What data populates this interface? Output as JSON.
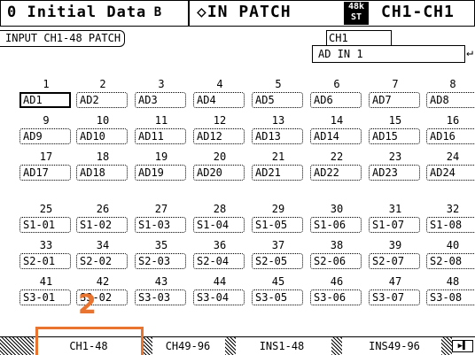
{
  "title_bar": {
    "scene": "0 Initial Data",
    "scene_icon": "B",
    "screen": "◇IN PATCH",
    "fs_top": "48k",
    "fs_bottom": "ST",
    "channel": "CH1-CH1"
  },
  "header": {
    "page_label": "INPUT CH1-48 PATCH",
    "selected_channel": "CH1",
    "selected_source": "AD IN 1",
    "source_arrow": "↵"
  },
  "channels": {
    "numbers": [
      "1",
      "2",
      "3",
      "4",
      "5",
      "6",
      "7",
      "8",
      "9",
      "10",
      "11",
      "12",
      "13",
      "14",
      "15",
      "16",
      "17",
      "18",
      "19",
      "20",
      "21",
      "22",
      "23",
      "24",
      "25",
      "26",
      "27",
      "28",
      "29",
      "30",
      "31",
      "32",
      "33",
      "34",
      "35",
      "36",
      "37",
      "38",
      "39",
      "40",
      "41",
      "42",
      "43",
      "44",
      "45",
      "46",
      "47",
      "48"
    ],
    "sources": [
      "AD1",
      "AD2",
      "AD3",
      "AD4",
      "AD5",
      "AD6",
      "AD7",
      "AD8",
      "AD9",
      "AD10",
      "AD11",
      "AD12",
      "AD13",
      "AD14",
      "AD15",
      "AD16",
      "AD17",
      "AD18",
      "AD19",
      "AD20",
      "AD21",
      "AD22",
      "AD23",
      "AD24",
      "S1-01",
      "S1-02",
      "S1-03",
      "S1-04",
      "S1-05",
      "S1-06",
      "S1-07",
      "S1-08",
      "S2-01",
      "S2-02",
      "S2-03",
      "S2-04",
      "S2-05",
      "S2-06",
      "S2-07",
      "S2-08",
      "S3-01",
      "S3-02",
      "S3-03",
      "S3-04",
      "S3-05",
      "S3-06",
      "S3-07",
      "S3-08"
    ],
    "selected": "1"
  },
  "tabs": [
    "CH1-48",
    "CH49-96",
    "INS1-48",
    "INS49-96"
  ],
  "tab_scroll": "▶▌",
  "annotation": {
    "number": "2",
    "color": "#e9742f"
  }
}
